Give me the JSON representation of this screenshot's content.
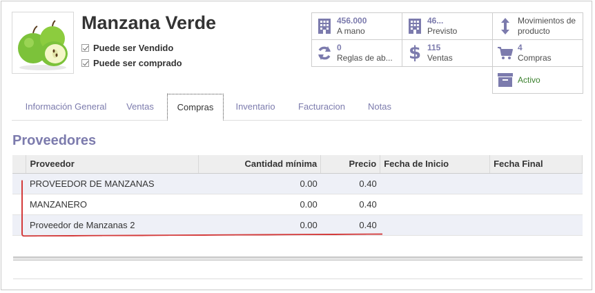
{
  "product": {
    "name": "Manzana Verde",
    "can_be_sold": "Puede ser Vendido",
    "can_be_purchased": "Puede ser comprado",
    "image": "green-apples-image"
  },
  "stats": {
    "on_hand": {
      "value": "456.000",
      "label": "A mano",
      "icon": "building-icon"
    },
    "forecast": {
      "value": "46...",
      "label": "Previsto",
      "icon": "building-icon"
    },
    "moves": {
      "label_line1": "Movimientos de",
      "label_line2": "producto",
      "icon": "up-down-arrow-icon"
    },
    "reorder": {
      "value": "0",
      "label": "Reglas de ab...",
      "icon": "refresh-icon"
    },
    "sales": {
      "value": "115",
      "label": "Ventas",
      "icon": "dollar-icon"
    },
    "purchases": {
      "value": "4",
      "label": "Compras",
      "icon": "cart-icon"
    },
    "active": {
      "label": "Activo",
      "icon": "archive-icon",
      "color": "#3a7f2c"
    }
  },
  "tabs": [
    {
      "label": "Información General"
    },
    {
      "label": "Ventas"
    },
    {
      "label": "Compras"
    },
    {
      "label": "Inventario"
    },
    {
      "label": "Facturacion"
    },
    {
      "label": "Notas"
    }
  ],
  "active_tab": "Compras",
  "vendors": {
    "title": "Proveedores",
    "columns": [
      "Proveedor",
      "Cantidad mínima",
      "Precio",
      "Fecha de Inicio",
      "Fecha Final"
    ],
    "rows": [
      {
        "vendor": "PROVEEDOR DE MANZANAS",
        "min_qty": "0.00",
        "price": "0.40",
        "start": "",
        "end": ""
      },
      {
        "vendor": "MANZANERO",
        "min_qty": "0.00",
        "price": "0.40",
        "start": "",
        "end": ""
      },
      {
        "vendor": "Proveedor de Manzanas 2",
        "min_qty": "0.00",
        "price": "0.40",
        "start": "",
        "end": ""
      }
    ]
  },
  "colors": {
    "accent": "#7c7bad",
    "annotation": "#d43a3a",
    "active_green": "#3a7f2c"
  }
}
